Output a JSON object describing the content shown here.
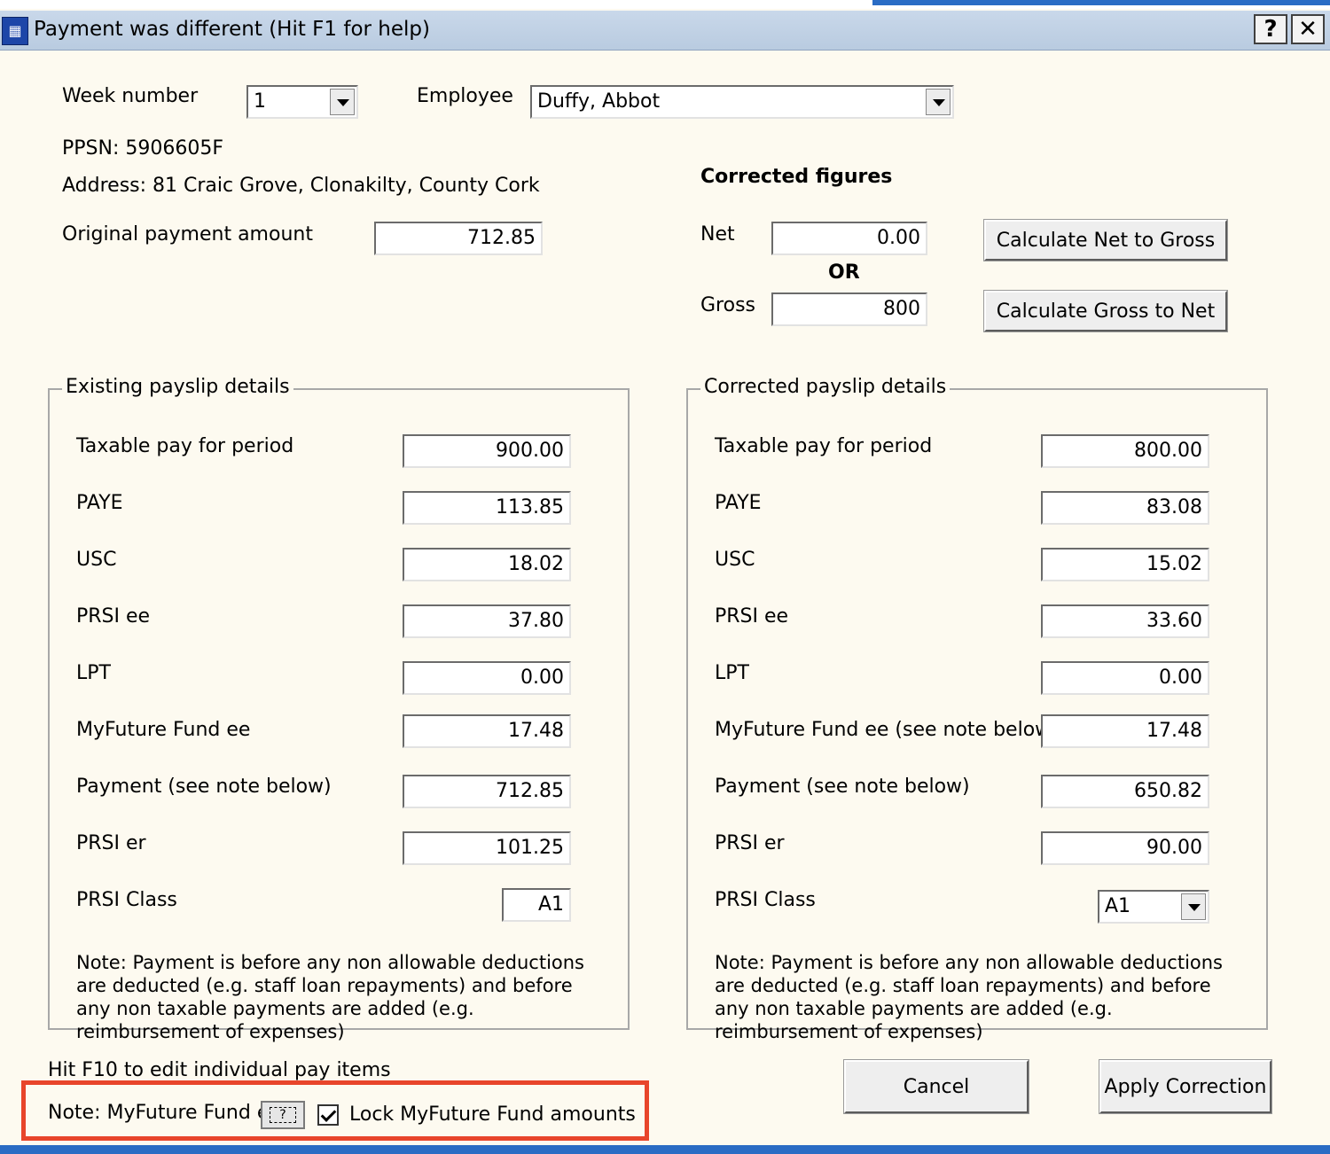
{
  "window": {
    "title": "Payment was different (Hit F1 for help)",
    "help_button": "?",
    "close_button": "✕"
  },
  "header": {
    "week_label": "Week number",
    "week_value": "1",
    "employee_label": "Employee",
    "employee_value": "Duffy, Abbot",
    "ppsn": "PPSN: 5906605F",
    "address": "Address: 81 Craic Grove, Clonakilty, County Cork",
    "original_payment_label": "Original payment amount",
    "original_payment_value": "712.85"
  },
  "corrected_figures": {
    "heading": "Corrected figures",
    "net_label": "Net",
    "net_value": "0.00",
    "or_label": "OR",
    "gross_label": "Gross",
    "gross_value": "800",
    "net_to_gross_button": "Calculate Net to Gross",
    "gross_to_net_button": "Calculate Gross to Net"
  },
  "existing": {
    "legend": "Existing payslip details",
    "rows": [
      {
        "label": "Taxable pay for period",
        "value": "900.00"
      },
      {
        "label": "PAYE",
        "value": "113.85"
      },
      {
        "label": "USC",
        "value": "18.02"
      },
      {
        "label": "PRSI ee",
        "value": "37.80"
      },
      {
        "label": "LPT",
        "value": "0.00"
      },
      {
        "label": "MyFuture Fund ee",
        "value": "17.48"
      },
      {
        "label": "Payment (see note below)",
        "value": "712.85"
      },
      {
        "label": "PRSI er",
        "value": "101.25"
      }
    ],
    "prsi_class_label": "PRSI Class",
    "prsi_class_value": "A1",
    "note": "Note: Payment is before any non allowable deductions are deducted (e.g. staff loan repayments) and before any non taxable payments are added (e.g. reimbursement of expenses)"
  },
  "corrected": {
    "legend": "Corrected payslip details",
    "rows": [
      {
        "label": "Taxable pay for period",
        "value": "800.00"
      },
      {
        "label": "PAYE",
        "value": "83.08"
      },
      {
        "label": "USC",
        "value": "15.02"
      },
      {
        "label": "PRSI ee",
        "value": "33.60"
      },
      {
        "label": "LPT",
        "value": "0.00"
      },
      {
        "label": "MyFuture Fund ee (see note below)",
        "value": "17.48"
      },
      {
        "label": "Payment (see note below)",
        "value": "650.82"
      },
      {
        "label": "PRSI er",
        "value": "90.00"
      }
    ],
    "prsi_class_label": "PRSI Class",
    "prsi_class_value": "A1",
    "note": "Note: Payment is before any non allowable deductions are deducted (e.g. staff loan repayments) and before any non taxable payments are added (e.g. reimbursement of expenses)"
  },
  "footer": {
    "f10_hint": "Hit F10 to edit individual pay items",
    "myfuture_note_label": "Note: MyFuture Fund ee",
    "note_button_glyph": "?",
    "lock_label": "Lock MyFuture Fund amounts",
    "lock_checked": true,
    "cancel_button": "Cancel",
    "apply_button": "Apply Correction"
  },
  "colors": {
    "highlight": "#e8452b",
    "dialog_background": "#fdfaf0",
    "titlebar": "#c9d8ea"
  }
}
